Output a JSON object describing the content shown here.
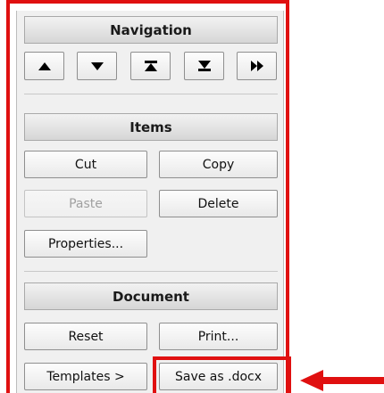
{
  "panel": {
    "navigation": {
      "header": "Navigation",
      "buttons": [
        {
          "icon": "move-up-icon"
        },
        {
          "icon": "move-down-icon"
        },
        {
          "icon": "move-to-top-icon"
        },
        {
          "icon": "move-to-bottom-icon"
        },
        {
          "icon": "fast-forward-icon"
        }
      ]
    },
    "items": {
      "header": "Items",
      "cut": "Cut",
      "copy": "Copy",
      "paste": "Paste",
      "delete": "Delete",
      "properties": "Properties..."
    },
    "document": {
      "header": "Document",
      "reset": "Reset",
      "print": "Print...",
      "templates": "Templates >",
      "save_docx": "Save as .docx"
    }
  },
  "annotations": {
    "highlight_color": "#e01010",
    "arrow_target": "save-as-docx-button"
  }
}
